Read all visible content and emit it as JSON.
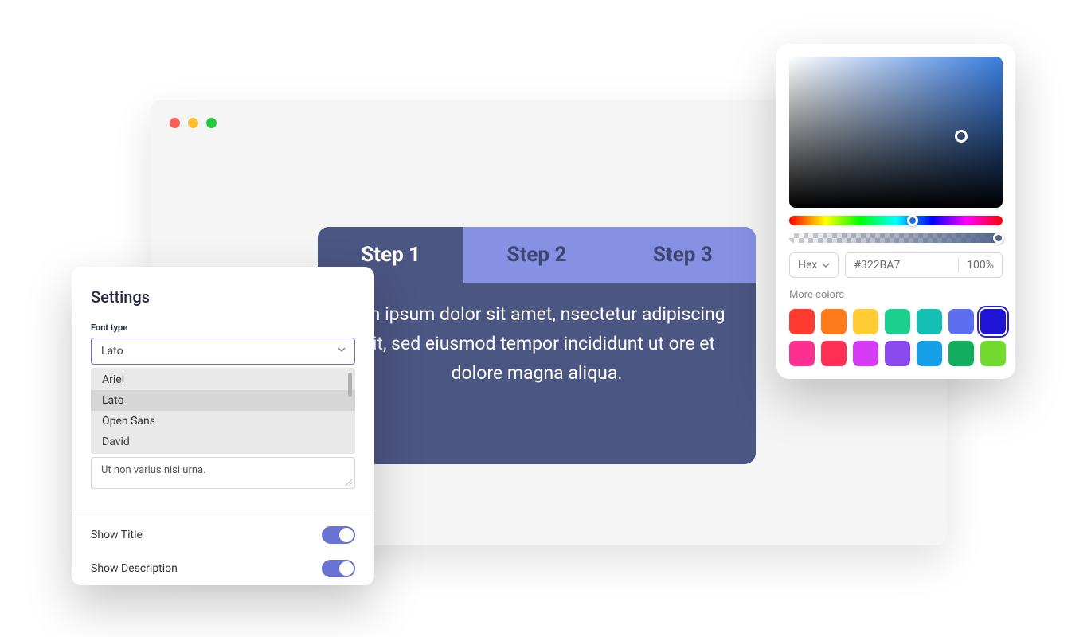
{
  "browser": {
    "traffic_lights": [
      "red",
      "yellow",
      "green"
    ]
  },
  "steps": {
    "tabs": [
      {
        "label": "Step 1",
        "active": true
      },
      {
        "label": "Step 2",
        "active": false
      },
      {
        "label": "Step 3",
        "active": false
      }
    ],
    "body_text": "rem ipsum dolor sit amet, nsectetur adipiscing elit, sed eiusmod tempor incididunt ut ore et dolore magna aliqua."
  },
  "settings": {
    "title": "Settings",
    "font_type_label": "Font type",
    "font_type_value": "Lato",
    "font_options": [
      "Ariel",
      "Lato",
      "Open Sans",
      "David"
    ],
    "font_selected_index": 1,
    "textarea_value": "Ut non varius nisi urna.",
    "show_title_label": "Show Title",
    "show_title_on": true,
    "show_description_label": "Show Description",
    "show_description_on": true
  },
  "color_picker": {
    "format_label": "Hex",
    "hex_value": "#322BA7",
    "opacity_value": "100%",
    "more_colors_label": "More colors",
    "swatches": [
      {
        "color": "#ff3b30",
        "selected": false
      },
      {
        "color": "#ff7a1a",
        "selected": false
      },
      {
        "color": "#ffcc33",
        "selected": false
      },
      {
        "color": "#1dcf8e",
        "selected": false
      },
      {
        "color": "#14c0b3",
        "selected": false
      },
      {
        "color": "#5e6ef0",
        "selected": false
      },
      {
        "color": "#1f13d6",
        "selected": true
      },
      {
        "color": "#ff2f92",
        "selected": false
      },
      {
        "color": "#ff2f55",
        "selected": false
      },
      {
        "color": "#d53bf5",
        "selected": false
      },
      {
        "color": "#8a4af0",
        "selected": false
      },
      {
        "color": "#149fe6",
        "selected": false
      },
      {
        "color": "#12ad5e",
        "selected": false
      },
      {
        "color": "#72d92e",
        "selected": false
      }
    ]
  }
}
